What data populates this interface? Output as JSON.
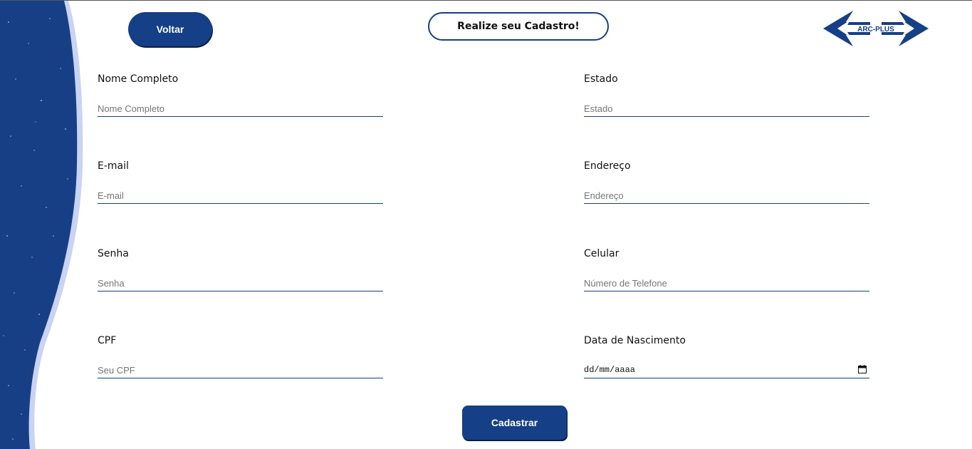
{
  "header": {
    "back_label": "Voltar",
    "title": "Realize seu Cadastro!",
    "logo_text": "ARC-PLUS"
  },
  "form": {
    "left": [
      {
        "label": "Nome Completo",
        "placeholder": "Nome Completo"
      },
      {
        "label": "E-mail",
        "placeholder": "E-mail"
      },
      {
        "label": "Senha",
        "placeholder": "Senha"
      },
      {
        "label": "CPF",
        "placeholder": "Seu CPF"
      }
    ],
    "right": [
      {
        "label": "Estado",
        "placeholder": "Estado"
      },
      {
        "label": "Endereço",
        "placeholder": "Endereço"
      },
      {
        "label": "Celular",
        "placeholder": "Número de Telefone"
      },
      {
        "label": "Data de Nascimento",
        "placeholder": "dd/mm/aaaa"
      }
    ],
    "submit_label": "Cadastrar"
  },
  "colors": {
    "primary": "#153f86",
    "side_light": "#c9d3f2",
    "text": "#111111"
  },
  "icons": {
    "date_picker": "calendar-icon",
    "logo": "double-arrow-logo"
  }
}
